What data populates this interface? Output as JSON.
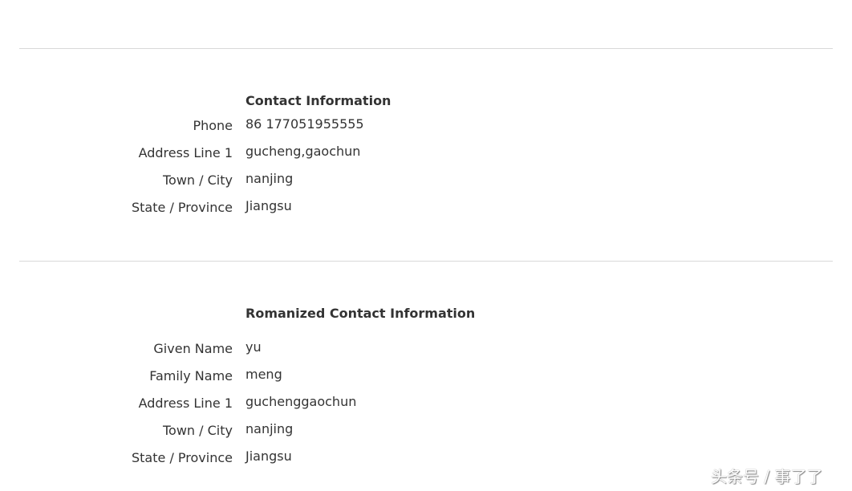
{
  "contact": {
    "heading": "Contact Information",
    "rows": [
      {
        "label": "Phone",
        "value": "86 177051955555"
      },
      {
        "label": "Address Line 1",
        "value": "gucheng,gaochun"
      },
      {
        "label": "Town / City",
        "value": "nanjing"
      },
      {
        "label": "State / Province",
        "value": "Jiangsu"
      }
    ]
  },
  "romanized": {
    "heading": "Romanized Contact Information",
    "rows": [
      {
        "label": "Given Name",
        "value": "yu"
      },
      {
        "label": "Family Name",
        "value": "meng"
      },
      {
        "label": "Address Line 1",
        "value": "guchenggaochun"
      },
      {
        "label": "Town / City",
        "value": "nanjing"
      },
      {
        "label": "State / Province",
        "value": "Jiangsu"
      }
    ]
  },
  "watermark": "头条号 / 事了了"
}
